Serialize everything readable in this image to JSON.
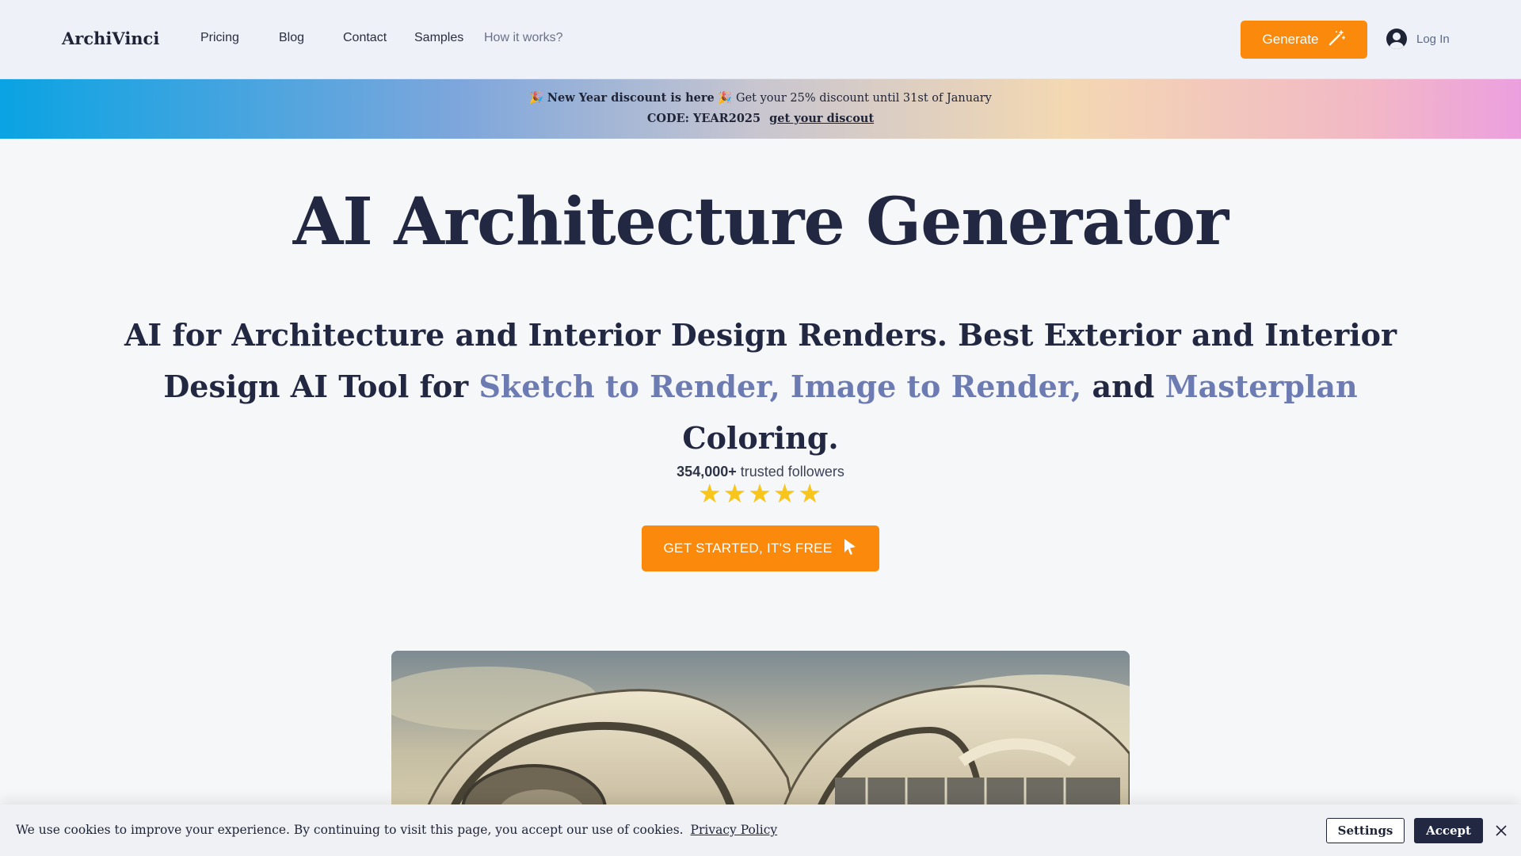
{
  "nav": {
    "logo": "ArchiVinci",
    "links": [
      "Pricing",
      "Blog",
      "Contact",
      "Samples",
      "How it works?"
    ],
    "generate_label": "Generate",
    "login_label": "Log In"
  },
  "promo": {
    "emoji": "🎉",
    "highlight": "New Year discount is here",
    "offer": "Get your 25% discount until 31st of January",
    "code": "CODE: YEAR2025",
    "link_label": "get your discout"
  },
  "hero": {
    "title": "AI Architecture Generator",
    "subtitle_part1": "AI for Architecture and Interior Design Renders. Best Exterior and Interior Design AI Tool for",
    "subtitle_highlight1": "Sketch to Render, Image to Render,",
    "subtitle_and": "and",
    "subtitle_highlight2": "Masterplan",
    "subtitle_end": "Coloring.",
    "followers_count": "354,000+",
    "followers_label": "trusted followers",
    "rating_stars": 5,
    "stars_text": "★★★★★",
    "cta_label": "GET STARTED, IT'S FREE"
  },
  "cookie": {
    "message": "We use cookies to improve your experience. By continuing to visit this page, you accept our use of cookies.",
    "policy_label": "Privacy Policy",
    "settings_label": "Settings",
    "accept_label": "Accept"
  },
  "colors": {
    "accent_orange": "#fb8a0c",
    "dark_navy": "#232842",
    "highlight_blue": "#6d7bb3",
    "star_yellow": "#f7c51c"
  },
  "icons": {
    "generate": "magic-wand-icon",
    "login": "user-avatar-icon",
    "cta": "arrow-cursor-icon",
    "close": "close-icon"
  }
}
